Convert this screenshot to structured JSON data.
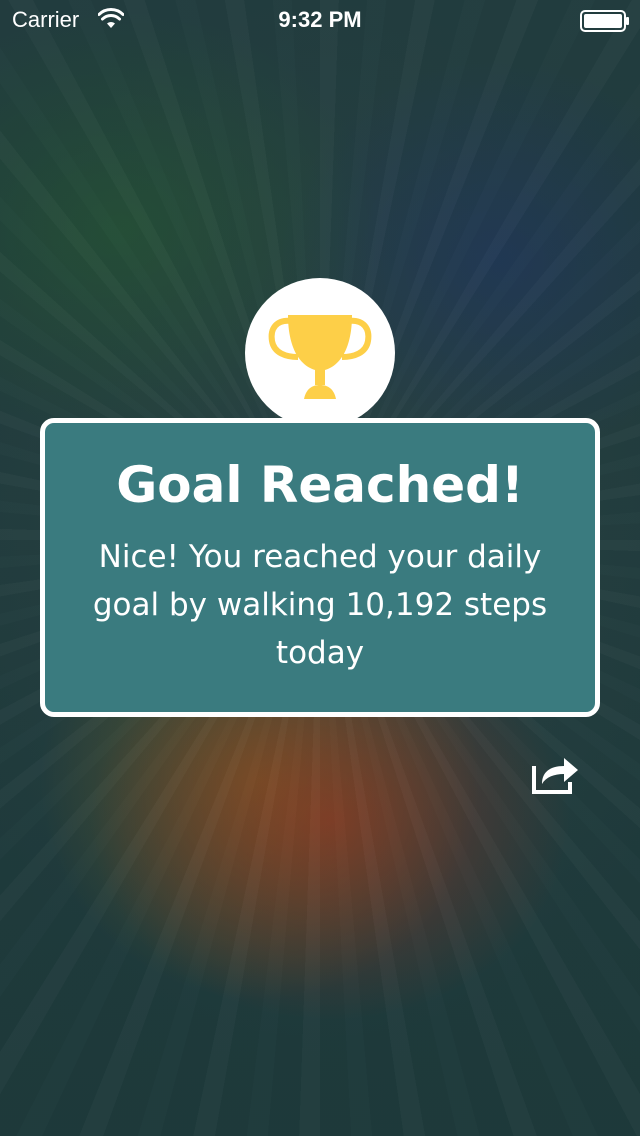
{
  "status_bar": {
    "carrier": "Carrier",
    "time": "9:32 PM",
    "wifi_icon": "wifi-icon",
    "battery_icon": "battery-icon"
  },
  "goal_card": {
    "title": "Goal Reached!",
    "message": "Nice! You reached your daily goal by walking 10,192 steps today",
    "trophy_icon": "trophy-icon",
    "trophy_color": "#FDCF48",
    "card_color": "#3A7B7F"
  },
  "actions": {
    "share_icon": "share-icon"
  }
}
